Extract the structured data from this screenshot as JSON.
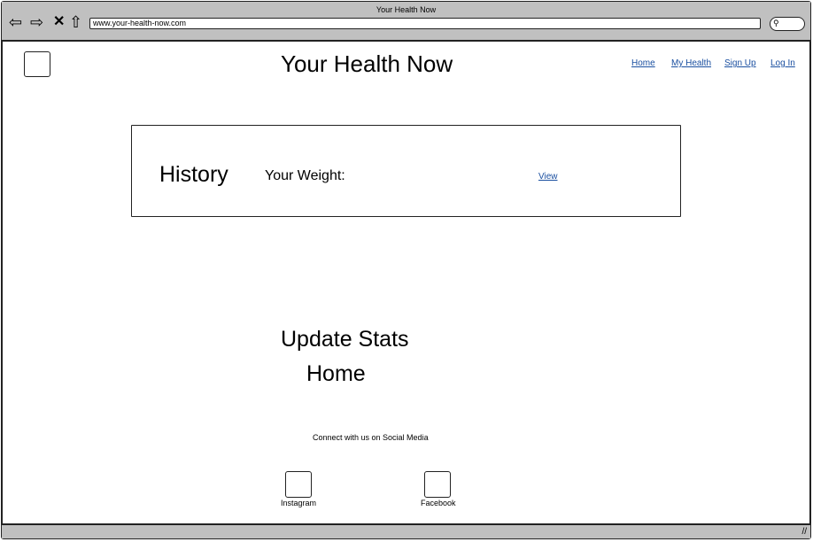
{
  "browser": {
    "title": "Your Health Now",
    "url": "www.your-health-now.com"
  },
  "header": {
    "site_title": "Your Health Now",
    "nav": [
      "Home",
      "My Health",
      "Sign Up",
      "Log In"
    ]
  },
  "history": {
    "title": "History",
    "weight_label": "Your Weight:",
    "view_link": "View"
  },
  "links": {
    "update_stats": "Update Stats",
    "home": "Home"
  },
  "footer": {
    "social_text": "Connect with us on Social Media",
    "social": [
      "Instagram",
      "Facebook"
    ]
  }
}
